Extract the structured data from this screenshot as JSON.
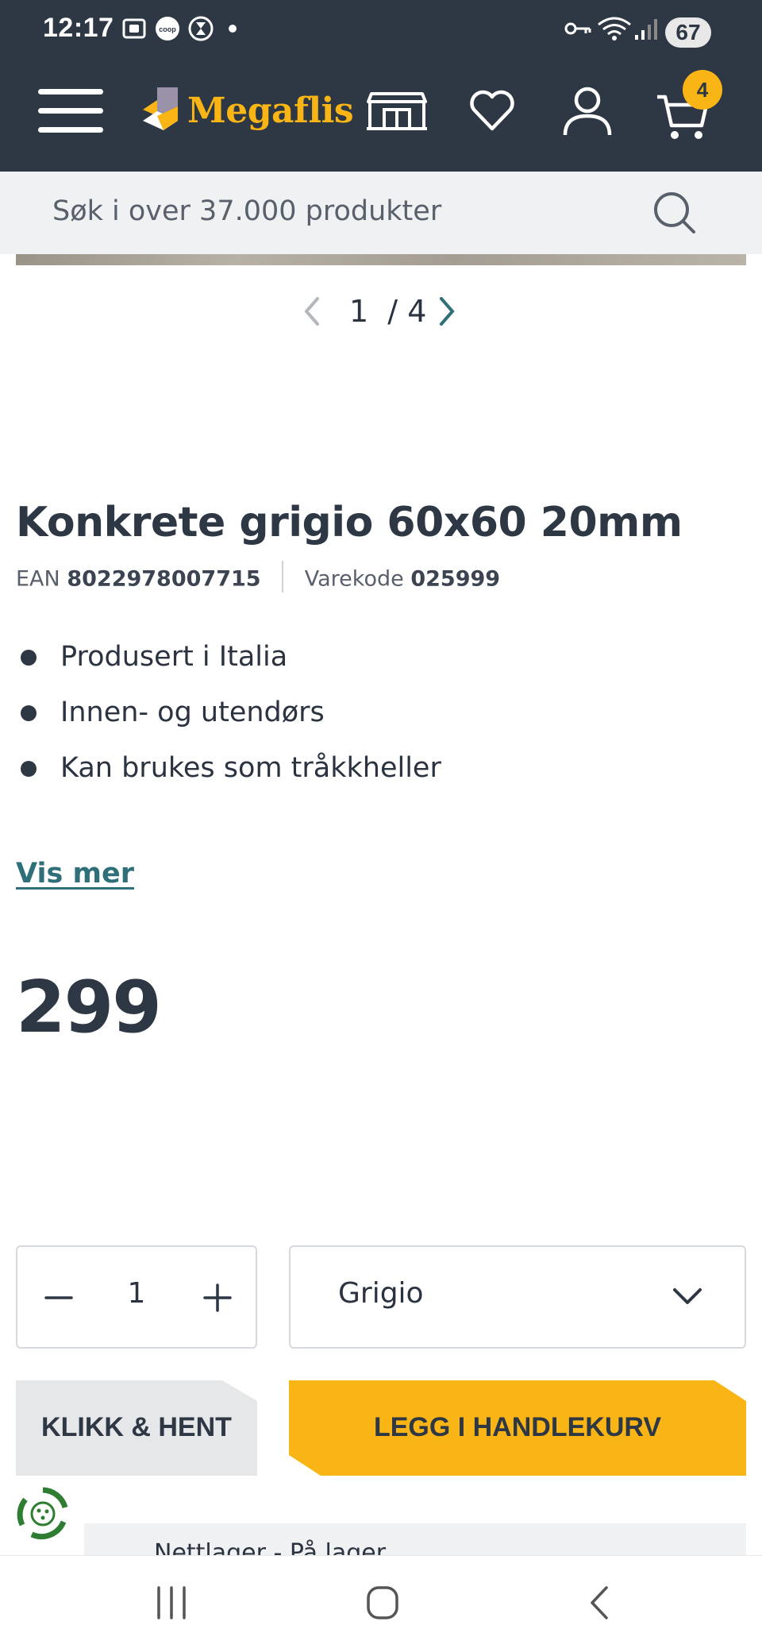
{
  "status_bar": {
    "time": "12:17",
    "battery": "67"
  },
  "header": {
    "brand": "Megaflis",
    "cart_count": "4",
    "icons": [
      "menu-icon",
      "store-icon",
      "heart-icon",
      "user-icon",
      "cart-icon"
    ]
  },
  "search": {
    "placeholder": "Søk i over 37.000 produkter"
  },
  "gallery": {
    "current": "1",
    "separator": "/",
    "total": "4"
  },
  "product": {
    "title": "Konkrete grigio 60x60 20mm",
    "ean_label": "EAN",
    "ean": "8022978007715",
    "code_label": "Varekode",
    "code": "025999",
    "features": [
      "Produsert i Italia",
      "Innen- og utendørs",
      "Kan brukes som tråkkheller"
    ],
    "more_label": "Vis mer",
    "price": "299"
  },
  "purchase": {
    "quantity": "1",
    "variant": "Grigio",
    "click_collect_label": "KLIKK & HENT",
    "add_to_cart_label": "LEGG I HANDLEKURV"
  },
  "stock": {
    "text": "Nettlager - På lager"
  },
  "colors": {
    "header_bg": "#2e3744",
    "accent": "#f8b515",
    "link": "#2f6f7a"
  }
}
